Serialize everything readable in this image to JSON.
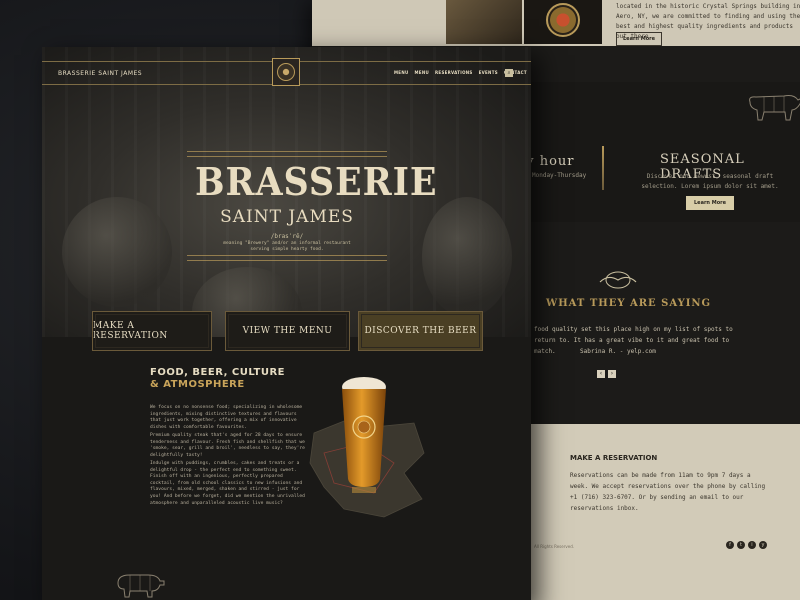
{
  "back": {
    "intro": "located in the historic Crystal Springs building in Aero, NY, we are committed to finding and using the best and highest quality ingredients and products out there.",
    "intro_button": "Learn More",
    "happy_hour_title": "ty hour",
    "happy_hour_sub": "Monday-Thursday",
    "seasonal_title": "SEASONAL DRAFTS",
    "seasonal_desc": "Discover our newest, seasonal draft selection. Lorem ipsum dolor sit amet.",
    "seasonal_button": "Learn More",
    "testimonials_title": "WHAT THEY ARE SAYING",
    "testimonial_quote": "food quality set this place high on my list of spots to return to. It has a great vibe to it and great food to match.",
    "testimonial_author": "Sabrina R. - yelp.com",
    "arrow_prev": "‹",
    "arrow_next": "›",
    "reservation_title": "MAKE A RESERVATION",
    "reservation_text": "Reservations can be made from 11am to 9pm 7 days a week. We accept reservations over the phone by calling +1 (716) 323-6707. Or by sending an email to our reservations inbox.",
    "copyright": "All Rights Reserved.",
    "social": [
      "f",
      "t",
      "i",
      "y"
    ]
  },
  "nav": {
    "brand": "BRASSERIE SAINT JAMES",
    "items": [
      "MENU",
      "MENU",
      "RESERVATIONS",
      "EVENTS",
      "CONTACT"
    ],
    "search_icon": "⌕"
  },
  "hero": {
    "title": "BRASSERIE",
    "subtitle": "SAINT JAMES",
    "phonetic": "/brasˈrē/",
    "meaning": "meaning \"Brewery\" and/or an informal restaurant serving simple hearty food."
  },
  "about": {
    "heading_line1": "FOOD, BEER, CULTURE",
    "heading_line2": "& ATMOSPHERE",
    "p1": "We focus on no nonsense food; specializing in wholesome ingredients, mixing distinctive textures and flavours that just work together, offering a mix of innovative dishes with comfortable favourites.",
    "p2": "Premium quality steak that's aged for 28 days to ensure tenderness and flavour. Fresh fish and shellfish that we 'smoke, sear, grill and broil', needless to say, they're delightfully tasty!",
    "p3": "Indulge with puddings, crumbles, cakes and treats or a delightful drop - the perfect end to something sweet. Finish off with an ingenious, perfectly prepared cocktail, from old school classics to new infusions and flavours, mixed, merged, shaken and stirred - just for you! And before we forget, did we mention the unrivalled atmosphere and unparalleled acoustic live music?"
  },
  "cta": {
    "reservation": "MAKE A RESERVATION",
    "menu": "VIEW THE MENU",
    "beer": "DISCOVER THE BEER"
  }
}
